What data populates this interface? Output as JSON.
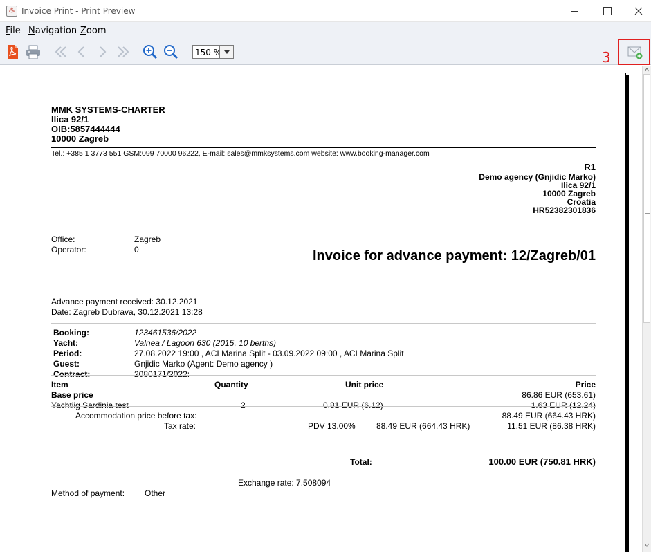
{
  "window": {
    "title": "Invoice Print - Print Preview"
  },
  "menu": {
    "file": "File",
    "navigation": "Navigation",
    "zoom": "Zoom"
  },
  "toolbar": {
    "zoom_value": "150 %",
    "annotation_number": "3"
  },
  "invoice": {
    "company": {
      "name": "MMK SYSTEMS-CHARTER",
      "street": "Ilica 92/1",
      "oib": "OIB:5857444444",
      "city": "10000 Zagreb"
    },
    "contact_line": "Tel.: +385 1 3773 551 GSM:099 70000 96222, E-mail: sales@mmksystems.com website: www.booking-manager.com",
    "customer": {
      "code": "R1",
      "name": "Demo agency (Gnjidic Marko)",
      "street": "Ilica 92/1",
      "city": "10000 Zagreb",
      "country": "Croatia",
      "vat": "HR52382301836"
    },
    "office_label": "Office:",
    "office_value": "Zagreb",
    "operator_label": "Operator:",
    "operator_value": "0",
    "title": "Invoice for advance payment: 12/Zagreb/01",
    "advance_received": "Advance payment received: 30.12.2021",
    "date_line": "Date: Zagreb Dubrava, 30.12.2021 13:28",
    "booking": {
      "booking_label": "Booking:",
      "booking_value": "123461536/2022",
      "yacht_label": "Yacht:",
      "yacht_value": "Valnea / Lagoon 630 (2015, 10 berths)",
      "period_label": "Period:",
      "period_value": "27.08.2022 19:00 , ACI Marina Split - 03.09.2022 09:00 , ACI Marina Split",
      "guest_label": "Guest:",
      "guest_value": "Gnjidic Marko (Agent: Demo agency )",
      "contract_label": "Contract:",
      "contract_value": "2080171/2022:"
    },
    "table": {
      "headers": {
        "item": "Item",
        "quantity": "Quantity",
        "unit_price": "Unit price",
        "price": "Price"
      },
      "base_label": "Base price",
      "base_price": "86.86 EUR (653.61)",
      "row": {
        "item": "Yachtiig Sardinia test",
        "quantity": "2",
        "unit_price": "0.81 EUR (6.12)",
        "price": "1.63 EUR (12.24)"
      },
      "accommodation_label": "Accommodation price before tax:",
      "accommodation_value": "88.49  EUR (664.43 HRK)",
      "tax_label": "Tax rate:",
      "tax_rate": "PDV 13.00%",
      "tax_base": "88.49 EUR (664.43  HRK)",
      "tax_value": "11.51 EUR (86.38  HRK)"
    },
    "total_label": "Total:",
    "total_value": "100.00  EUR (750.81  HRK)",
    "exchange_rate": "Exchange rate: 7.508094",
    "payment_label": "Method of payment:",
    "payment_value": "Other"
  },
  "colors": {
    "annotation": "#e02020",
    "pdf_icon": "#e8501e",
    "zoom_icon": "#1e66c8",
    "nav_disabled": "#b9c1cc"
  }
}
